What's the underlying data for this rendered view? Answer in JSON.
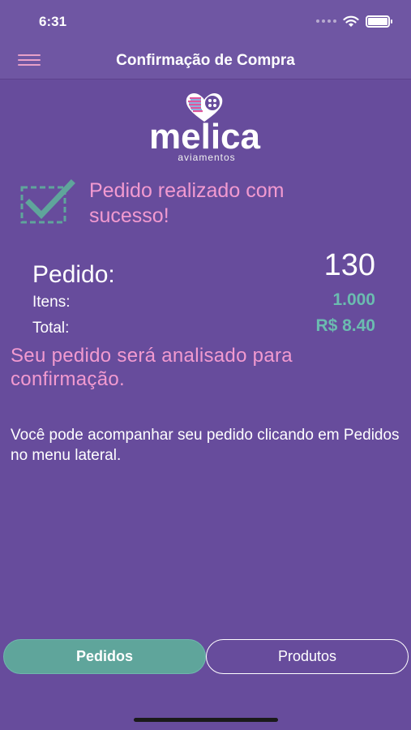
{
  "status_bar": {
    "time": "6:31"
  },
  "nav": {
    "title": "Confirmação de Compra"
  },
  "logo": {
    "name": "melica",
    "subtitle": "aviamentos"
  },
  "confirmation": {
    "message": "Pedido realizado com sucesso!"
  },
  "order": {
    "label": "Pedido:",
    "number": "130",
    "items_label": "Itens:",
    "items_value": "1.000",
    "total_label": "Total:",
    "total_value": "R$ 8.40"
  },
  "analysis_text": "Seu pedido será analisado para confirmação.",
  "info_text": "Você pode acompanhar seu pedido clicando em Pedidos no menu lateral.",
  "buttons": {
    "orders": "Pedidos",
    "products": "Produtos"
  },
  "colors": {
    "background": "#674c9c",
    "header": "#6f56a3",
    "pink": "#f29ad0",
    "teal": "#5fa59b",
    "teal_text": "#6bbcb0"
  }
}
